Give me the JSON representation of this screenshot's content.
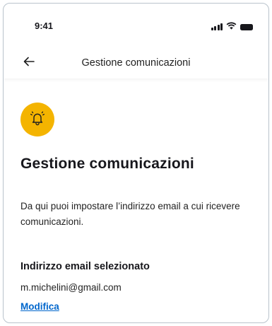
{
  "status_bar": {
    "time": "9:41",
    "icons": [
      "signal-icon",
      "wifi-icon",
      "battery-icon"
    ]
  },
  "app_bar": {
    "back_icon": "arrow-left-icon",
    "title": "Gestione comunicazioni"
  },
  "main": {
    "badge_icon": "bell-icon",
    "badge_color": "#F4B400",
    "title": "Gestione comunicazioni",
    "description": "Da qui puoi impostare l’indirizzo email a cui ricevere comunicazioni.",
    "email_section": {
      "label": "Indirizzo email selezionato",
      "value": "m.michelini@gmail.com",
      "edit_link": "Modifica"
    }
  },
  "colors": {
    "link": "#0066CC",
    "text": "#17171C"
  }
}
